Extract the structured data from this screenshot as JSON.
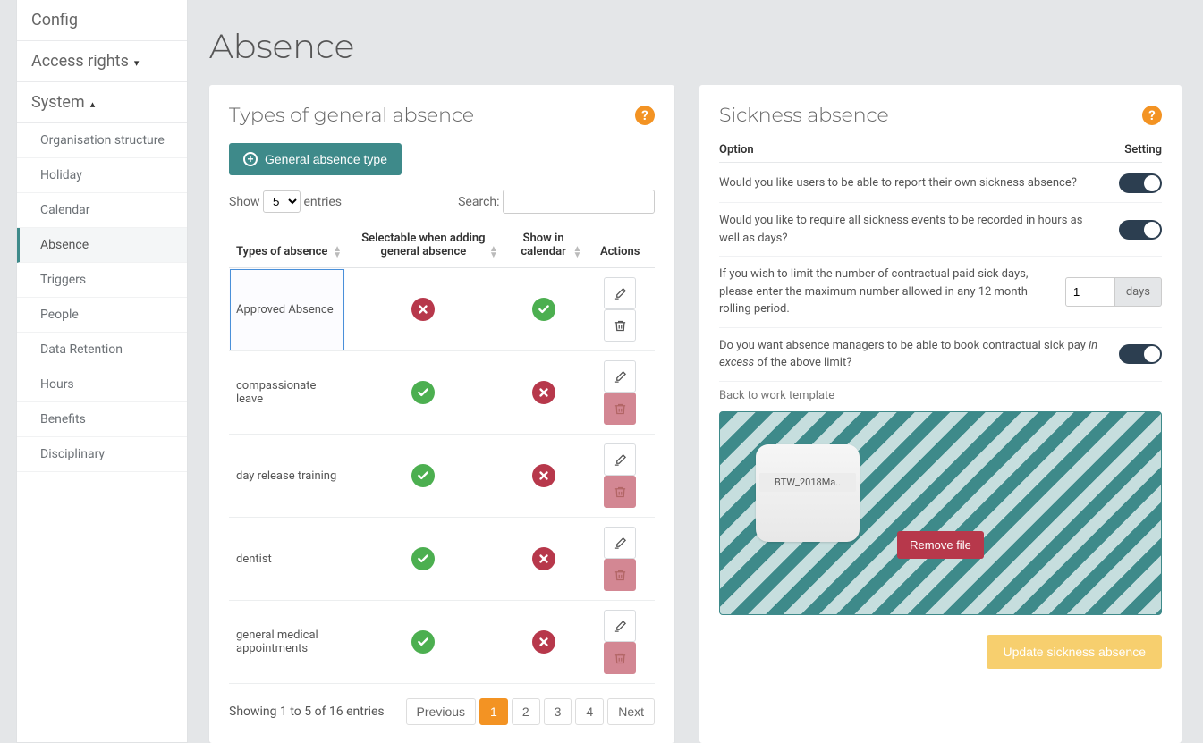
{
  "sidebar": {
    "top": [
      {
        "label": "Config",
        "collapsible": false
      },
      {
        "label": "Access rights",
        "collapsible": true,
        "expanded": false
      },
      {
        "label": "System",
        "collapsible": true,
        "expanded": true
      }
    ],
    "system_items": [
      {
        "label": "Organisation structure",
        "active": false
      },
      {
        "label": "Holiday",
        "active": false
      },
      {
        "label": "Calendar",
        "active": false
      },
      {
        "label": "Absence",
        "active": true
      },
      {
        "label": "Triggers",
        "active": false
      },
      {
        "label": "People",
        "active": false
      },
      {
        "label": "Data Retention",
        "active": false
      },
      {
        "label": "Hours",
        "active": false
      },
      {
        "label": "Benefits",
        "active": false
      },
      {
        "label": "Disciplinary",
        "active": false
      }
    ]
  },
  "page": {
    "title": "Absence"
  },
  "types_panel": {
    "title": "Types of general absence",
    "add_button": "General absence type",
    "show_label": "Show",
    "entries_label": "entries",
    "page_length": "5",
    "search_label": "Search:",
    "search_value": "",
    "columns": {
      "c0": "Types of absence",
      "c1": "Selectable when adding general absence",
      "c2": "Show in calendar",
      "c3": "Actions"
    },
    "rows": [
      {
        "name": "Approved Absence",
        "selectable": false,
        "show_cal": true,
        "del_enabled": true,
        "selected": true
      },
      {
        "name": "compassionate leave",
        "selectable": true,
        "show_cal": false,
        "del_enabled": false,
        "selected": false
      },
      {
        "name": "day release training",
        "selectable": true,
        "show_cal": false,
        "del_enabled": false,
        "selected": false
      },
      {
        "name": "dentist",
        "selectable": true,
        "show_cal": false,
        "del_enabled": false,
        "selected": false
      },
      {
        "name": "general medical appointments",
        "selectable": true,
        "show_cal": false,
        "del_enabled": false,
        "selected": false
      }
    ],
    "info_text": "Showing 1 to 5 of 16 entries",
    "pager": {
      "prev": "Previous",
      "next": "Next",
      "pages": [
        "1",
        "2",
        "3",
        "4"
      ],
      "current": "1"
    }
  },
  "sickness_panel": {
    "title": "Sickness absence",
    "col_option": "Option",
    "col_setting": "Setting",
    "opts": {
      "o1_pre": "Would you like users to be able to report their own sickness absence?",
      "o2_pre": "Would you like to require all sickness events to be recorded in hours as well as days?",
      "o3_pre": "If you wish to limit the number of contractual paid sick days, please enter the maximum number allowed in any 12 month rolling period.",
      "o3_value": "1",
      "o3_unit": "days",
      "o4_pre": "Do you want absence managers to be able to book contractual sick pay ",
      "o4_em": "in excess",
      "o4_post": " of the above limit?"
    },
    "btw_label": "Back to work template",
    "file_name": "BTW_2018Ma..",
    "remove_label": "Remove file",
    "update_label": "Update sickness absence"
  }
}
